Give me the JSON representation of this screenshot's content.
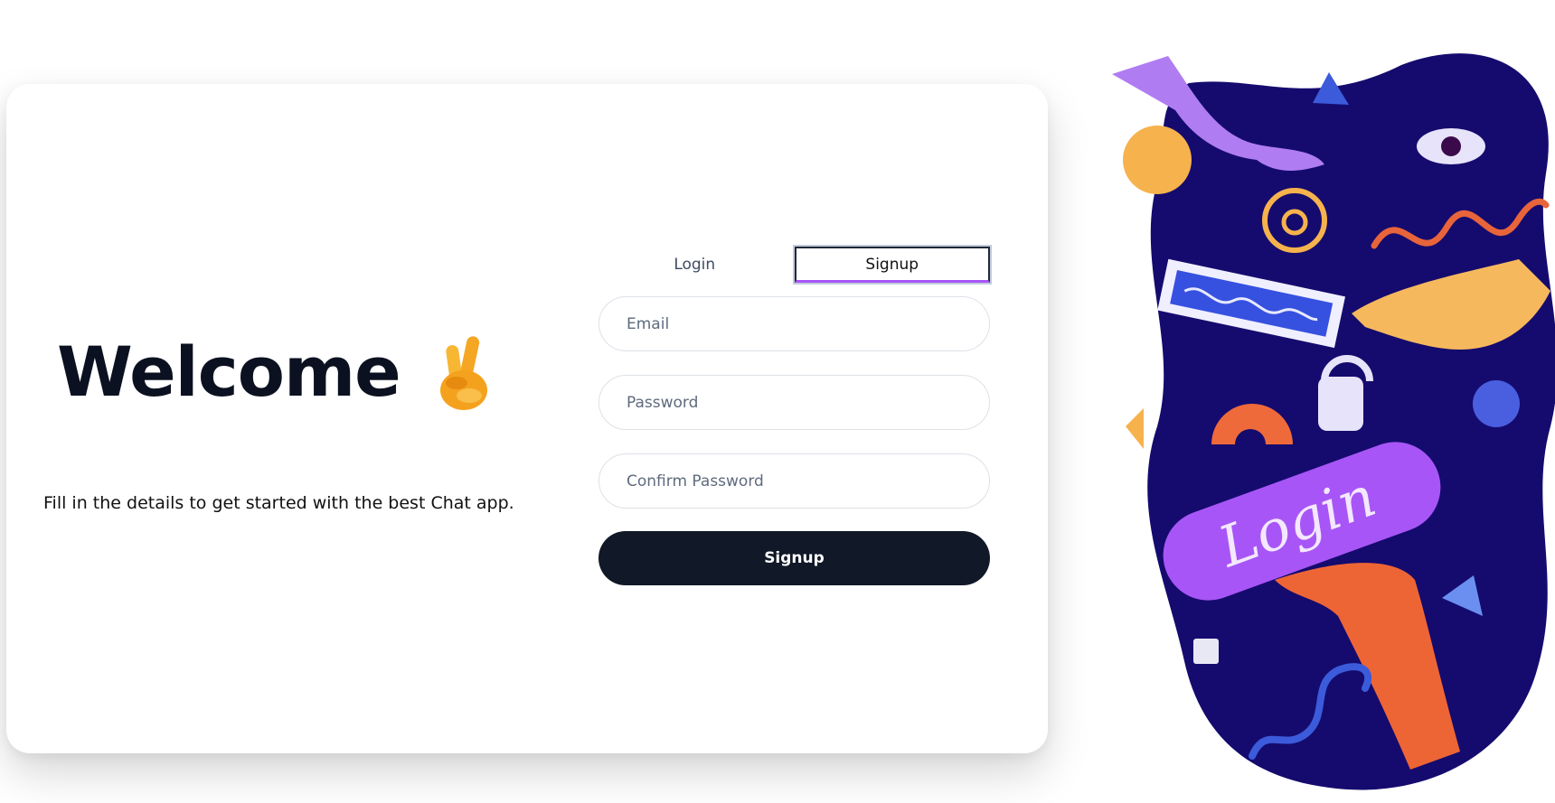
{
  "hero": {
    "title": "Welcome",
    "icon": "victory-hand-emoji",
    "subtitle": "Fill in the details to get started with the best Chat app."
  },
  "tabs": [
    {
      "label": "Login",
      "active": false
    },
    {
      "label": "Signup",
      "active": true
    }
  ],
  "form": {
    "email_placeholder": "Email",
    "password_placeholder": "Password",
    "confirm_password_placeholder": "Confirm Password",
    "submit_label": "Signup"
  },
  "illustration": {
    "caption": "Login"
  },
  "colors": {
    "primary_button": "#111827",
    "active_tab_underline": "#a855f7",
    "illustration_background": "#150b6e"
  }
}
